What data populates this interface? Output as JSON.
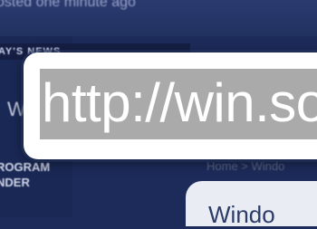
{
  "header": {
    "posted_text": "osted one minute ago"
  },
  "sidebar": {
    "news_label": "AY'S NEWS",
    "item_initial": "W",
    "program_line1": "ROGRAM",
    "program_line2": "NDER"
  },
  "main": {
    "breadcrumb": "Home > Windo",
    "article_title": "Windo"
  },
  "zoom": {
    "url_text": "http://win.so"
  },
  "colors": {
    "page_background": "#1d2b5a",
    "selection_highlight": "#aaaaaa",
    "zoom_frame": "#ffffff"
  }
}
